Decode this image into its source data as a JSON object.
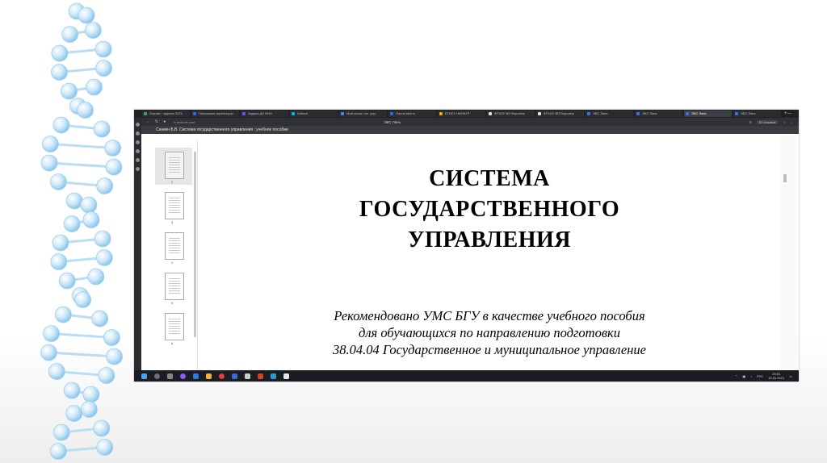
{
  "browser": {
    "tabs": [
      {
        "label": "Оценки · журнал 2021",
        "color": "#34a853"
      },
      {
        "label": "Поисковые агрегаторы",
        "color": "#1a73e8"
      },
      {
        "label": "Задачи ДЗ ФИЭ",
        "color": "#6d4aff"
      },
      {
        "label": "Kahoot",
        "color": "#00b3ff"
      },
      {
        "label": "Мой поиск: гос. упр.",
        "color": "#4285f4"
      },
      {
        "label": "Почта Mail.ru",
        "color": "#1a73e8"
      },
      {
        "label": "ЕГИСУ НИОКТР",
        "color": "#f4a300"
      },
      {
        "label": "ФГБОУ ВО Воронеж",
        "color": "#e0e0e0"
      },
      {
        "label": "ФГБОУ ВО Воронеж",
        "color": "#e0e0e0"
      },
      {
        "label": "ЭБС Лань",
        "color": "#3d6df2"
      },
      {
        "label": "ЭБС Лань",
        "color": "#3d6df2"
      },
      {
        "label": "ЭБС Лань",
        "color": "#3d6df2"
      },
      {
        "label": "ЭБС Лань",
        "color": "#3d6df2"
      }
    ],
    "new_tab": "+",
    "url": "e.lanbook.com",
    "page_title": "ЭБС Лань",
    "reviews_badge": "67 отзывов",
    "min": "—",
    "max": "❐",
    "close": "✕"
  },
  "document": {
    "header": "Санкин Б.В. Система государственного управления : учебное пособие",
    "title_lines": [
      "СИСТЕМА",
      "ГОСУДАРСТВЕННОГО",
      "УПРАВЛЕНИЯ"
    ],
    "subtitle_lines": [
      "Рекомендовано УМС БГУ в качестве учебного пособия",
      "для обучающихся по направлению подготовки",
      "38.04.04 Государственное и муниципальное управление"
    ]
  },
  "thumbnails": {
    "page_numbers": [
      "2",
      "3",
      "4",
      "5",
      "6"
    ]
  },
  "taskbar": {
    "tray_lang": "РУС",
    "time": "23:51",
    "date": "10.01.2021"
  }
}
